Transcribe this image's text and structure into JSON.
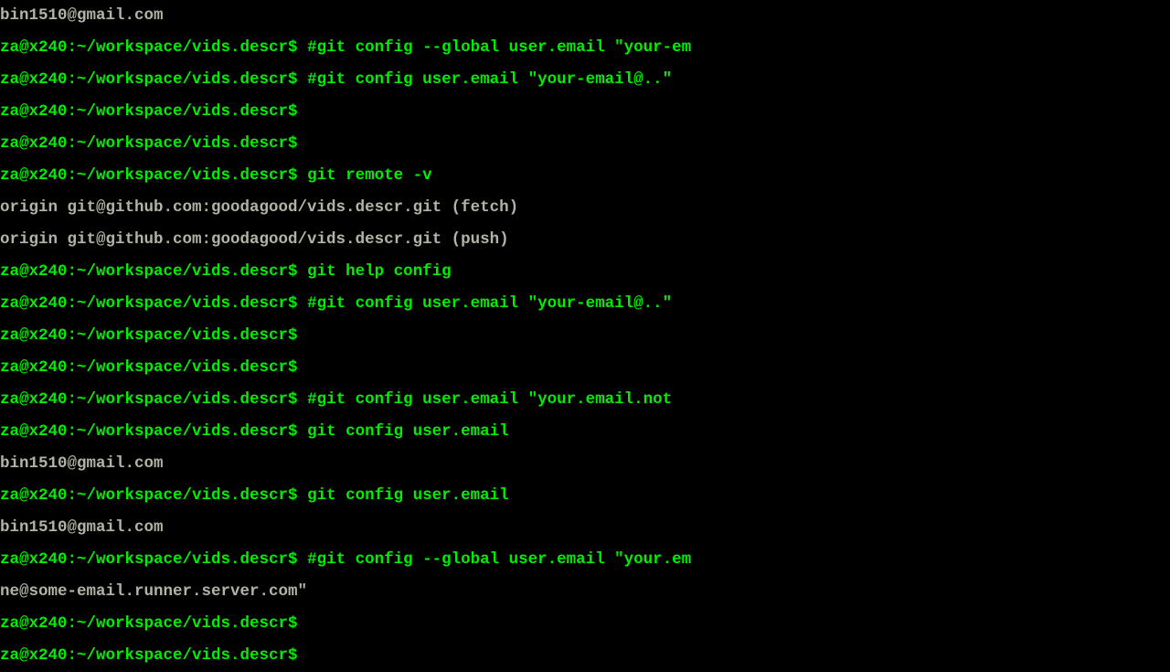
{
  "prompt": "za@x240:~/workspace/vids.descr$",
  "lines": [
    {
      "type": "output",
      "text": "bin1510@gmail.com"
    },
    {
      "type": "cmd",
      "command": " #git config --global user.email  \"your-em"
    },
    {
      "type": "cmd",
      "command": " #git config user.email  \"your-email@..\""
    },
    {
      "type": "cmd",
      "command": ""
    },
    {
      "type": "cmd",
      "command": ""
    },
    {
      "type": "cmd",
      "command": " git remote  -v"
    },
    {
      "type": "output",
      "text": "origin  git@github.com:goodagood/vids.descr.git (fetch)"
    },
    {
      "type": "output",
      "text": "origin  git@github.com:goodagood/vids.descr.git (push)"
    },
    {
      "type": "cmd",
      "command": " git help config"
    },
    {
      "type": "cmd",
      "command": " #git config user.email  \"your-email@..\""
    },
    {
      "type": "cmd",
      "command": ""
    },
    {
      "type": "cmd",
      "command": ""
    },
    {
      "type": "cmd",
      "command": " #git   config user.email  \"your.email.not"
    },
    {
      "type": "cmd",
      "command": " git config user.email"
    },
    {
      "type": "output",
      "text": "bin1510@gmail.com"
    },
    {
      "type": "cmd",
      "command": " git config user.email"
    },
    {
      "type": "output",
      "text": "bin1510@gmail.com"
    },
    {
      "type": "cmd",
      "command": " #git config --global  user.email \"your.em"
    },
    {
      "type": "output",
      "text": "ne@some-email.runner.server.com\""
    },
    {
      "type": "cmd",
      "command": ""
    },
    {
      "type": "cmd",
      "command": ""
    }
  ]
}
